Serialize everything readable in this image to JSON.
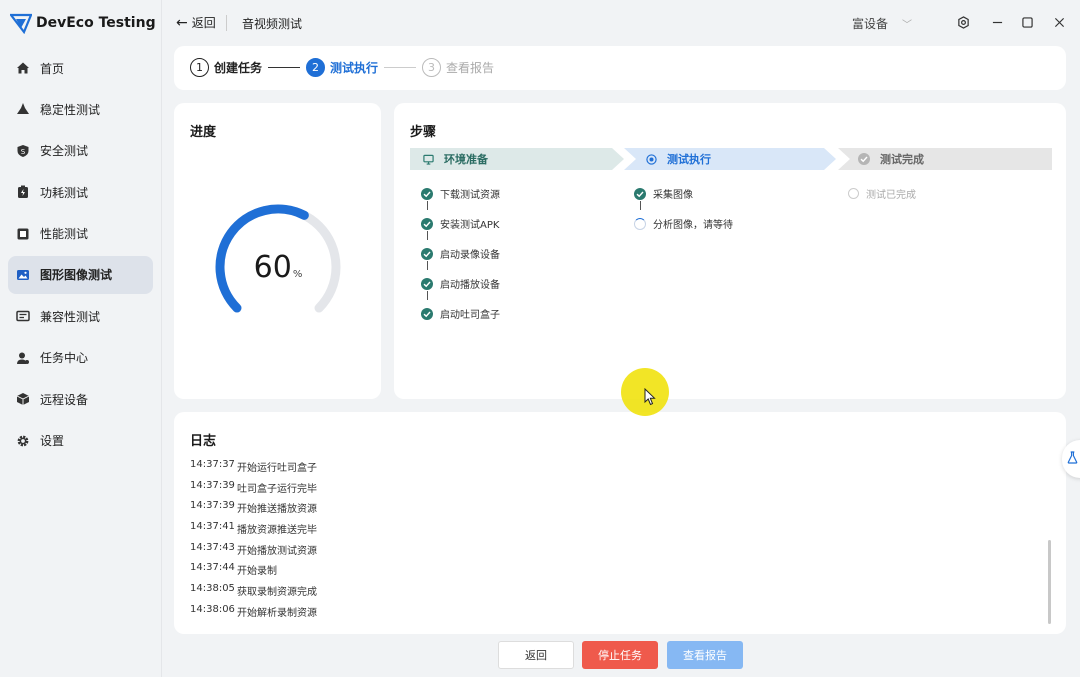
{
  "app": {
    "name": "DevEco Testing",
    "brand_color": "#1f6fd6"
  },
  "sidebar": {
    "items": [
      {
        "label": "首页",
        "icon": "home-icon",
        "active": false
      },
      {
        "label": "稳定性测试",
        "icon": "stability-icon",
        "active": false
      },
      {
        "label": "安全测试",
        "icon": "shield-icon",
        "active": false
      },
      {
        "label": "功耗测试",
        "icon": "battery-icon",
        "active": false
      },
      {
        "label": "性能测试",
        "icon": "performance-icon",
        "active": false
      },
      {
        "label": "图形图像测试",
        "icon": "image-icon",
        "active": true
      },
      {
        "label": "兼容性测试",
        "icon": "compatibility-icon",
        "active": false
      },
      {
        "label": "任务中心",
        "icon": "task-center-icon",
        "active": false
      },
      {
        "label": "远程设备",
        "icon": "remote-device-icon",
        "active": false
      },
      {
        "label": "设置",
        "icon": "gear-icon",
        "active": false
      }
    ]
  },
  "titlebar": {
    "back_label": "返回",
    "page_title": "音视频测试",
    "device_select": "富设备"
  },
  "stepper": [
    {
      "num": "1",
      "label": "创建任务",
      "state": "done"
    },
    {
      "num": "2",
      "label": "测试执行",
      "state": "active"
    },
    {
      "num": "3",
      "label": "查看报告",
      "state": "pending"
    }
  ],
  "progress": {
    "title": "进度",
    "value": "60",
    "unit": "%",
    "fraction": 0.6
  },
  "steps": {
    "title": "步骤",
    "phases": [
      {
        "label": "环境准备",
        "state": "done",
        "items": [
          {
            "label": "下载测试资源",
            "state": "done"
          },
          {
            "label": "安装测试APK",
            "state": "done"
          },
          {
            "label": "启动录像设备",
            "state": "done"
          },
          {
            "label": "启动播放设备",
            "state": "done"
          },
          {
            "label": "启动吐司盒子",
            "state": "done"
          }
        ]
      },
      {
        "label": "测试执行",
        "state": "active",
        "items": [
          {
            "label": "采集图像",
            "state": "done"
          },
          {
            "label": "分析图像，请等待",
            "state": "running"
          }
        ]
      },
      {
        "label": "测试完成",
        "state": "pending",
        "items": [
          {
            "label": "测试已完成",
            "state": "pending"
          }
        ]
      }
    ]
  },
  "log": {
    "title": "日志",
    "entries": [
      {
        "time": "14:37:37",
        "message": "开始运行吐司盒子"
      },
      {
        "time": "14:37:39",
        "message": "吐司盒子运行完毕"
      },
      {
        "time": "14:37:39",
        "message": "开始推送播放资源"
      },
      {
        "time": "14:37:41",
        "message": "播放资源推送完毕"
      },
      {
        "time": "14:37:43",
        "message": "开始播放测试资源"
      },
      {
        "time": "14:37:44",
        "message": "开始录制"
      },
      {
        "time": "14:38:05",
        "message": "获取录制资源完成"
      },
      {
        "time": "14:38:06",
        "message": "开始解析录制资源"
      }
    ]
  },
  "buttons": {
    "back": "返回",
    "stop": "停止任务",
    "report": "查看报告"
  },
  "colors": {
    "check": "#2b7a6f",
    "stop_button": "#ef5a4c",
    "report_button_disabled": "#86b8f3",
    "phase_done_bg": "#dde9e8",
    "phase_active_bg": "#d9e7f8",
    "phase_pending_bg": "#e6e6e6"
  }
}
